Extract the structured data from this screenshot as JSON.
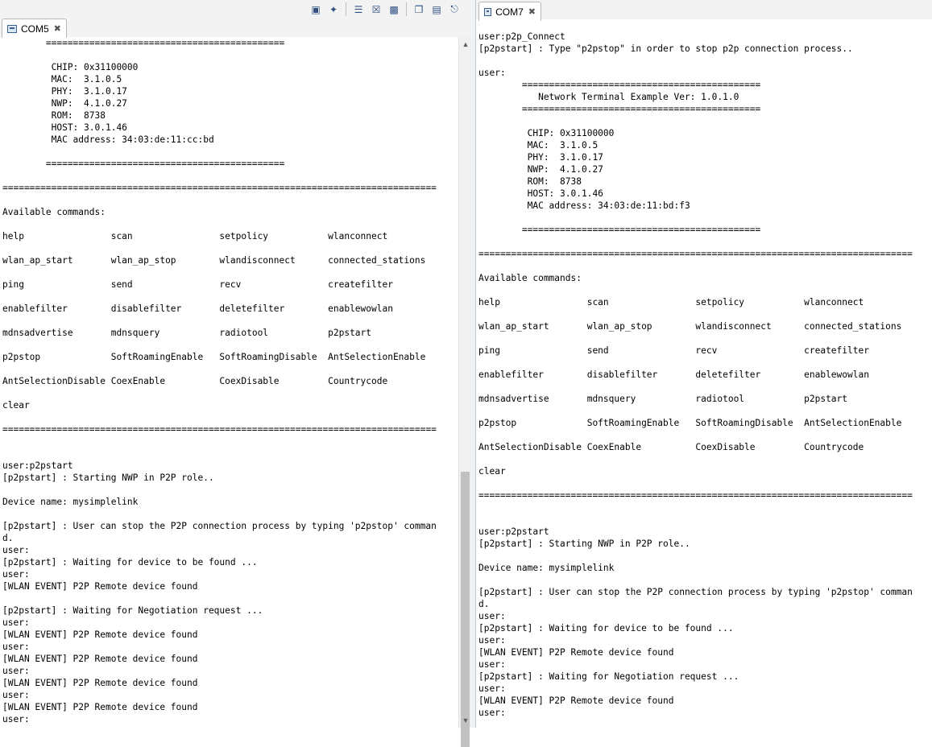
{
  "left": {
    "tab_label": "COM5",
    "toolbar_icons": [
      "display-icon",
      "pin-icon",
      "scroll-lock-icon",
      "clear-icon",
      "save-icon",
      "copy-icon",
      "paste-icon",
      "link-icon"
    ],
    "lines": [
      "        ============================================",
      "",
      "         CHIP: 0x31100000",
      "         MAC:  3.1.0.5",
      "         PHY:  3.1.0.17",
      "         NWP:  4.1.0.27",
      "         ROM:  8738",
      "         HOST: 3.0.1.46",
      "         MAC address: 34:03:de:11:cc:bd",
      "",
      "        ============================================",
      "",
      "================================================================================",
      "",
      "Available commands:",
      "",
      "help                scan                setpolicy           wlanconnect",
      "",
      "wlan_ap_start       wlan_ap_stop        wlandisconnect      connected_stations",
      "",
      "ping                send                recv                createfilter",
      "",
      "enablefilter        disablefilter       deletefilter        enablewowlan",
      "",
      "mdnsadvertise       mdnsquery           radiotool           p2pstart",
      "",
      "p2pstop             SoftRoamingEnable   SoftRoamingDisable  AntSelectionEnable",
      "",
      "AntSelectionDisable CoexEnable          CoexDisable         Countrycode",
      "",
      "clear",
      "",
      "================================================================================",
      "",
      "",
      "user:p2pstart",
      "[p2pstart] : Starting NWP in P2P role..",
      "",
      "Device name: mysimplelink",
      "",
      "[p2pstart] : User can stop the P2P connection process by typing 'p2pstop' comman",
      "d.",
      "user:",
      "[p2pstart] : Waiting for device to be found ...",
      "user:",
      "[WLAN EVENT] P2P Remote device found",
      "",
      "[p2pstart] : Waiting for Negotiation request ...",
      "user:",
      "[WLAN EVENT] P2P Remote device found",
      "user:",
      "[WLAN EVENT] P2P Remote device found",
      "user:",
      "[WLAN EVENT] P2P Remote device found",
      "user:",
      "[WLAN EVENT] P2P Remote device found",
      "user:"
    ]
  },
  "right": {
    "tab_label": "COM7",
    "lines": [
      "user:p2p_Connect",
      "[p2pstart] : Type \"p2pstop\" in order to stop p2p connection process..",
      "",
      "user:",
      "        ============================================",
      "           Network Terminal Example Ver: 1.0.1.0",
      "        ============================================",
      "",
      "         CHIP: 0x31100000",
      "         MAC:  3.1.0.5",
      "         PHY:  3.1.0.17",
      "         NWP:  4.1.0.27",
      "         ROM:  8738",
      "         HOST: 3.0.1.46",
      "         MAC address: 34:03:de:11:bd:f3",
      "",
      "        ============================================",
      "",
      "================================================================================",
      "",
      "Available commands:",
      "",
      "help                scan                setpolicy           wlanconnect",
      "",
      "wlan_ap_start       wlan_ap_stop        wlandisconnect      connected_stations",
      "",
      "ping                send                recv                createfilter",
      "",
      "enablefilter        disablefilter       deletefilter        enablewowlan",
      "",
      "mdnsadvertise       mdnsquery           radiotool           p2pstart",
      "",
      "p2pstop             SoftRoamingEnable   SoftRoamingDisable  AntSelectionEnable",
      "",
      "AntSelectionDisable CoexEnable          CoexDisable         Countrycode",
      "",
      "clear",
      "",
      "================================================================================",
      "",
      "",
      "user:p2pstart",
      "[p2pstart] : Starting NWP in P2P role..",
      "",
      "Device name: mysimplelink",
      "",
      "[p2pstart] : User can stop the P2P connection process by typing 'p2pstop' comman",
      "d.",
      "user:",
      "[p2pstart] : Waiting for device to be found ...",
      "user:",
      "[WLAN EVENT] P2P Remote device found",
      "user:",
      "[p2pstart] : Waiting for Negotiation request ...",
      "user:",
      "[WLAN EVENT] P2P Remote device found",
      "user:"
    ]
  }
}
